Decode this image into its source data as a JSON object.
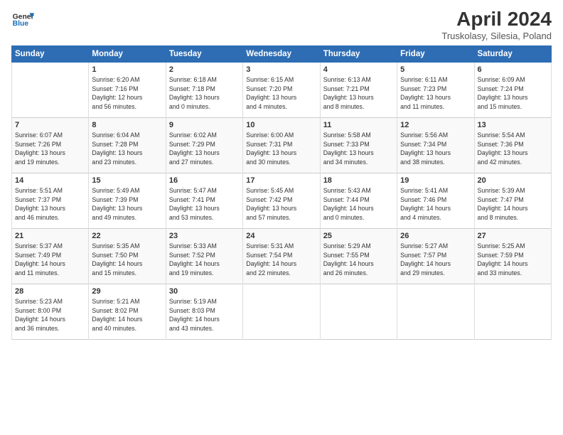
{
  "logo": {
    "line1": "General",
    "line2": "Blue"
  },
  "title": "April 2024",
  "subtitle": "Truskolasy, Silesia, Poland",
  "headers": [
    "Sunday",
    "Monday",
    "Tuesday",
    "Wednesday",
    "Thursday",
    "Friday",
    "Saturday"
  ],
  "weeks": [
    [
      {
        "day": "",
        "info": ""
      },
      {
        "day": "1",
        "info": "Sunrise: 6:20 AM\nSunset: 7:16 PM\nDaylight: 12 hours\nand 56 minutes."
      },
      {
        "day": "2",
        "info": "Sunrise: 6:18 AM\nSunset: 7:18 PM\nDaylight: 13 hours\nand 0 minutes."
      },
      {
        "day": "3",
        "info": "Sunrise: 6:15 AM\nSunset: 7:20 PM\nDaylight: 13 hours\nand 4 minutes."
      },
      {
        "day": "4",
        "info": "Sunrise: 6:13 AM\nSunset: 7:21 PM\nDaylight: 13 hours\nand 8 minutes."
      },
      {
        "day": "5",
        "info": "Sunrise: 6:11 AM\nSunset: 7:23 PM\nDaylight: 13 hours\nand 11 minutes."
      },
      {
        "day": "6",
        "info": "Sunrise: 6:09 AM\nSunset: 7:24 PM\nDaylight: 13 hours\nand 15 minutes."
      }
    ],
    [
      {
        "day": "7",
        "info": "Sunrise: 6:07 AM\nSunset: 7:26 PM\nDaylight: 13 hours\nand 19 minutes."
      },
      {
        "day": "8",
        "info": "Sunrise: 6:04 AM\nSunset: 7:28 PM\nDaylight: 13 hours\nand 23 minutes."
      },
      {
        "day": "9",
        "info": "Sunrise: 6:02 AM\nSunset: 7:29 PM\nDaylight: 13 hours\nand 27 minutes."
      },
      {
        "day": "10",
        "info": "Sunrise: 6:00 AM\nSunset: 7:31 PM\nDaylight: 13 hours\nand 30 minutes."
      },
      {
        "day": "11",
        "info": "Sunrise: 5:58 AM\nSunset: 7:33 PM\nDaylight: 13 hours\nand 34 minutes."
      },
      {
        "day": "12",
        "info": "Sunrise: 5:56 AM\nSunset: 7:34 PM\nDaylight: 13 hours\nand 38 minutes."
      },
      {
        "day": "13",
        "info": "Sunrise: 5:54 AM\nSunset: 7:36 PM\nDaylight: 13 hours\nand 42 minutes."
      }
    ],
    [
      {
        "day": "14",
        "info": "Sunrise: 5:51 AM\nSunset: 7:37 PM\nDaylight: 13 hours\nand 46 minutes."
      },
      {
        "day": "15",
        "info": "Sunrise: 5:49 AM\nSunset: 7:39 PM\nDaylight: 13 hours\nand 49 minutes."
      },
      {
        "day": "16",
        "info": "Sunrise: 5:47 AM\nSunset: 7:41 PM\nDaylight: 13 hours\nand 53 minutes."
      },
      {
        "day": "17",
        "info": "Sunrise: 5:45 AM\nSunset: 7:42 PM\nDaylight: 13 hours\nand 57 minutes."
      },
      {
        "day": "18",
        "info": "Sunrise: 5:43 AM\nSunset: 7:44 PM\nDaylight: 14 hours\nand 0 minutes."
      },
      {
        "day": "19",
        "info": "Sunrise: 5:41 AM\nSunset: 7:46 PM\nDaylight: 14 hours\nand 4 minutes."
      },
      {
        "day": "20",
        "info": "Sunrise: 5:39 AM\nSunset: 7:47 PM\nDaylight: 14 hours\nand 8 minutes."
      }
    ],
    [
      {
        "day": "21",
        "info": "Sunrise: 5:37 AM\nSunset: 7:49 PM\nDaylight: 14 hours\nand 11 minutes."
      },
      {
        "day": "22",
        "info": "Sunrise: 5:35 AM\nSunset: 7:50 PM\nDaylight: 14 hours\nand 15 minutes."
      },
      {
        "day": "23",
        "info": "Sunrise: 5:33 AM\nSunset: 7:52 PM\nDaylight: 14 hours\nand 19 minutes."
      },
      {
        "day": "24",
        "info": "Sunrise: 5:31 AM\nSunset: 7:54 PM\nDaylight: 14 hours\nand 22 minutes."
      },
      {
        "day": "25",
        "info": "Sunrise: 5:29 AM\nSunset: 7:55 PM\nDaylight: 14 hours\nand 26 minutes."
      },
      {
        "day": "26",
        "info": "Sunrise: 5:27 AM\nSunset: 7:57 PM\nDaylight: 14 hours\nand 29 minutes."
      },
      {
        "day": "27",
        "info": "Sunrise: 5:25 AM\nSunset: 7:59 PM\nDaylight: 14 hours\nand 33 minutes."
      }
    ],
    [
      {
        "day": "28",
        "info": "Sunrise: 5:23 AM\nSunset: 8:00 PM\nDaylight: 14 hours\nand 36 minutes."
      },
      {
        "day": "29",
        "info": "Sunrise: 5:21 AM\nSunset: 8:02 PM\nDaylight: 14 hours\nand 40 minutes."
      },
      {
        "day": "30",
        "info": "Sunrise: 5:19 AM\nSunset: 8:03 PM\nDaylight: 14 hours\nand 43 minutes."
      },
      {
        "day": "",
        "info": ""
      },
      {
        "day": "",
        "info": ""
      },
      {
        "day": "",
        "info": ""
      },
      {
        "day": "",
        "info": ""
      }
    ]
  ]
}
